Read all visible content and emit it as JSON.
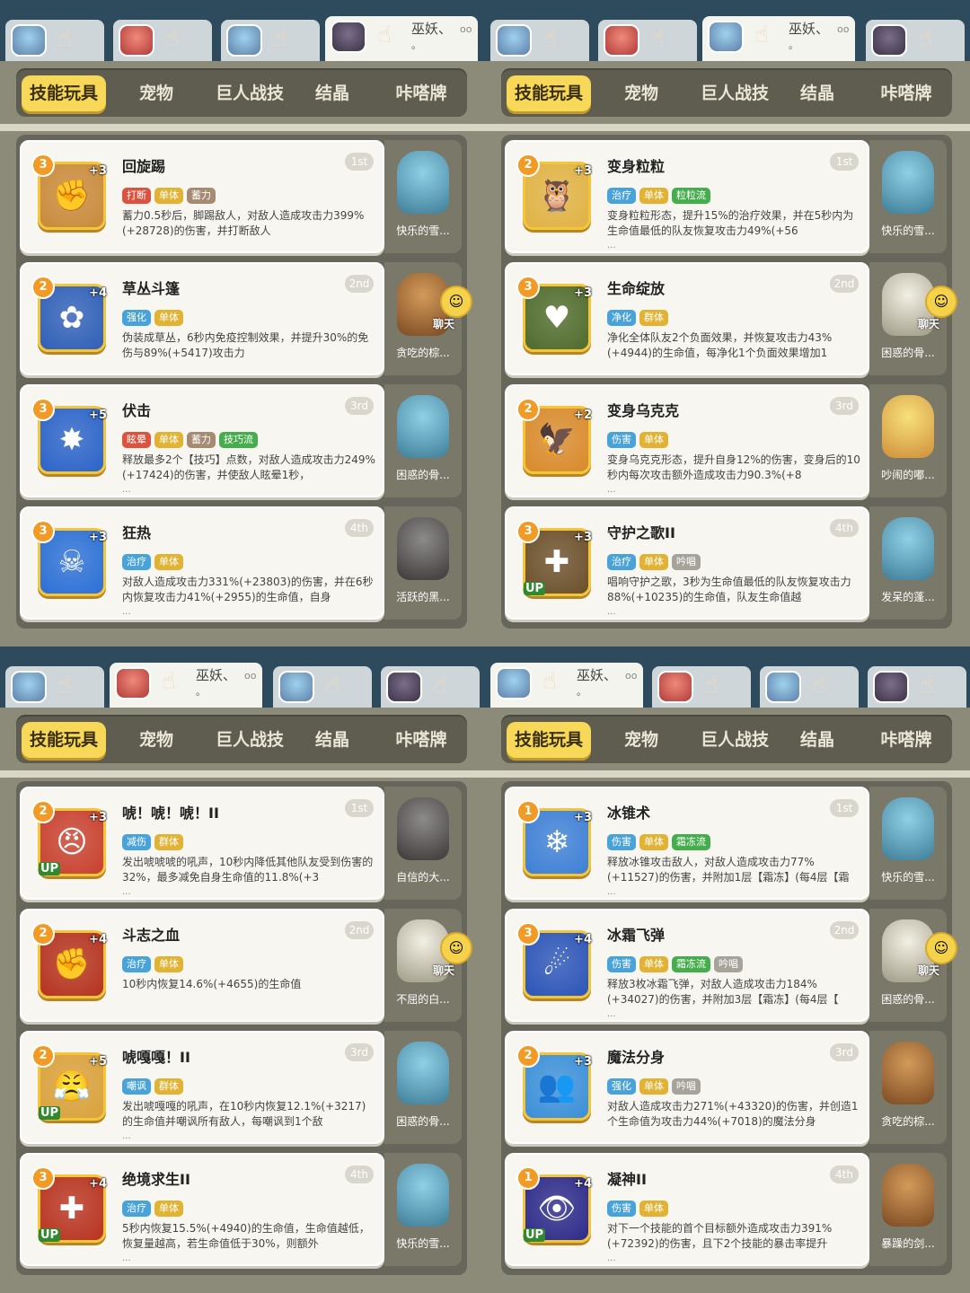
{
  "colors": {
    "tag_zhiliao": "#49a3d9",
    "tag_danti": "#e1b233",
    "tag_xuli": "#a58b72",
    "tag_daduan": "#d9533f",
    "tag_green": "#45ad4c",
    "tag_qianghua": "#49a3d9",
    "tag_qunti": "#e1b233",
    "tag_jinghua": "#49a3d9",
    "tag_yinchang": "#a6a39a",
    "tag_shanghai": "#49a3d9",
    "tag_xuanyun": "#d9533f",
    "tag_jianshang": "#49a3d9",
    "tag_chaofeng": "#49a3d9"
  },
  "quadrants": [
    {
      "player_tabs": [
        {
          "icon": "avatar-blue"
        },
        {
          "icon": "avatar-red"
        },
        {
          "icon": "avatar-blue"
        },
        {
          "name": "巫妖、",
          "dots": "oo",
          "sub": "。",
          "active": true,
          "icon": "avatar-dark"
        }
      ],
      "categories": [
        "技能玩具",
        "宠物",
        "巨人战技",
        "结晶",
        "咔嗒牌"
      ],
      "skills": [
        {
          "name": "回旋踢",
          "rank": "1st",
          "level": "3",
          "plus": "+3",
          "up": "",
          "tags": [
            {
              "t": "打断",
              "c": "tag_daduan"
            },
            {
              "t": "单体",
              "c": "tag_danti"
            },
            {
              "t": "蓄力",
              "c": "tag_xuli"
            }
          ],
          "desc": "蓄力0.5秒后，脚踢敌人，对敌人造成攻击力399%(+28728)的伤害，并打断敌人",
          "more": "",
          "icon_bg": "#c98a3a",
          "glyph": "✊",
          "pet": {
            "name": "快乐的雪...",
            "style": "p-blue",
            "chat": false
          }
        },
        {
          "name": "草丛斗篷",
          "rank": "2nd",
          "level": "2",
          "plus": "+4",
          "up": "",
          "tags": [
            {
              "t": "强化",
              "c": "tag_qianghua"
            },
            {
              "t": "单体",
              "c": "tag_danti"
            }
          ],
          "desc": "伪装成草丛，6秒内免疫控制效果，并提升30%的免伤与89%(+5417)攻击力",
          "more": "",
          "icon_bg": "#2f5fb8",
          "glyph": "✿",
          "pet": {
            "name": "贪吃的棕...",
            "style": "p-brown",
            "chat": true,
            "chat_label": "聊天"
          }
        },
        {
          "name": "伏击",
          "rank": "3rd",
          "level": "3",
          "plus": "+5",
          "up": "",
          "tags": [
            {
              "t": "眩晕",
              "c": "tag_xuanyun"
            },
            {
              "t": "单体",
              "c": "tag_danti"
            },
            {
              "t": "蓄力",
              "c": "tag_xuli"
            },
            {
              "t": "技巧流",
              "c": "tag_green"
            }
          ],
          "desc": "释放最多2个【技巧】点数，对敌人造成攻击力249%(+17424)的伤害，并使敌人眩晕1秒，",
          "more": "...",
          "icon_bg": "#2a63c9",
          "glyph": "✸",
          "pet": {
            "name": "困惑的骨...",
            "style": "p-blue",
            "chat": false
          }
        },
        {
          "name": "狂热",
          "rank": "4th",
          "level": "3",
          "plus": "+3",
          "up": "",
          "tags": [
            {
              "t": "治疗",
              "c": "tag_zhiliao"
            },
            {
              "t": "单体",
              "c": "tag_danti"
            }
          ],
          "desc": "对敌人造成攻击力331%(+23803)的伤害，并在6秒内恢复攻击力41%(+2955)的生命值，自身",
          "more": "...",
          "icon_bg": "#2b6fd6",
          "glyph": "☠",
          "pet": {
            "name": "活跃的黑...",
            "style": "p-dark",
            "chat": false
          }
        }
      ]
    },
    {
      "player_tabs": [
        {
          "icon": "avatar-blue"
        },
        {
          "icon": "avatar-red"
        },
        {
          "name": "巫妖、",
          "dots": "oo",
          "sub": "。",
          "active": true,
          "icon": "avatar-blue"
        },
        {
          "icon": "avatar-dark"
        }
      ],
      "categories": [
        "技能玩具",
        "宠物",
        "巨人战技",
        "结晶",
        "咔嗒牌"
      ],
      "skills": [
        {
          "name": "变身粒粒",
          "rank": "1st",
          "level": "2",
          "plus": "+3",
          "up": "",
          "tags": [
            {
              "t": "治疗",
              "c": "tag_zhiliao"
            },
            {
              "t": "单体",
              "c": "tag_danti"
            },
            {
              "t": "粒粒流",
              "c": "tag_green"
            }
          ],
          "desc": "变身粒粒形态，提升15%的治疗效果，并在5秒内为生命值最低的队友恢复攻击力49%(+56",
          "more": "...",
          "icon_bg": "#e0b243",
          "glyph": "🦉",
          "pet": {
            "name": "快乐的雪...",
            "style": "p-blue",
            "chat": false
          }
        },
        {
          "name": "生命绽放",
          "rank": "2nd",
          "level": "3",
          "plus": "+3",
          "up": "",
          "tags": [
            {
              "t": "净化",
              "c": "tag_jinghua"
            },
            {
              "t": "群体",
              "c": "tag_qunti"
            }
          ],
          "desc": "净化全体队友2个负面效果，并恢复攻击力43%(+4944)的生命值，每净化1个负面效果增加1",
          "more": "",
          "icon_bg": "#4f6b2c",
          "glyph": "♥",
          "pet": {
            "name": "困惑的骨...",
            "style": "p-white",
            "chat": true,
            "chat_label": "聊天"
          }
        },
        {
          "name": "变身乌克克",
          "rank": "3rd",
          "level": "2",
          "plus": "+2",
          "up": "",
          "tags": [
            {
              "t": "伤害",
              "c": "tag_shanghai"
            },
            {
              "t": "单体",
              "c": "tag_danti"
            }
          ],
          "desc": "变身乌克克形态，提升自身12%的伤害，变身后的10秒内每次攻击额外造成攻击力90.3%(+8",
          "more": "...",
          "icon_bg": "#d98a2a",
          "glyph": "🦅",
          "pet": {
            "name": "吵闹的嘟...",
            "style": "p-yellow",
            "chat": false
          }
        },
        {
          "name": "守护之歌II",
          "rank": "4th",
          "level": "3",
          "plus": "+3",
          "up": "UP",
          "tags": [
            {
              "t": "治疗",
              "c": "tag_zhiliao"
            },
            {
              "t": "单体",
              "c": "tag_danti"
            },
            {
              "t": "吟唱",
              "c": "tag_yinchang"
            }
          ],
          "desc": "唱响守护之歌，3秒为生命值最低的队友恢复攻击力88%(+10235)的生命值，队友生命值越",
          "more": "...",
          "icon_bg": "#6b4f2a",
          "glyph": "✚",
          "pet": {
            "name": "发呆的蓬...",
            "style": "p-blue",
            "chat": false
          }
        }
      ]
    },
    {
      "player_tabs": [
        {
          "icon": "avatar-blue"
        },
        {
          "name": "巫妖、",
          "dots": "oo",
          "sub": "。",
          "active": true,
          "icon": "avatar-red"
        },
        {
          "icon": "avatar-blue"
        },
        {
          "icon": "avatar-dark"
        }
      ],
      "categories": [
        "技能玩具",
        "宠物",
        "巨人战技",
        "结晶",
        "咔嗒牌"
      ],
      "skills": [
        {
          "name": "唬！唬！唬！II",
          "rank": "1st",
          "level": "2",
          "plus": "+3",
          "up": "UP",
          "tags": [
            {
              "t": "减伤",
              "c": "tag_jianshang"
            },
            {
              "t": "群体",
              "c": "tag_qunti"
            }
          ],
          "desc": "发出唬唬唬的吼声，10秒内降低其他队友受到伤害的32%，最多减免自身生命值的11.8%(+3",
          "more": "...",
          "icon_bg": "#c8402e",
          "glyph": "😠",
          "pet": {
            "name": "自信的大...",
            "style": "p-dark",
            "chat": false
          }
        },
        {
          "name": "斗志之血",
          "rank": "2nd",
          "level": "2",
          "plus": "+4",
          "up": "",
          "tags": [
            {
              "t": "治疗",
              "c": "tag_zhiliao"
            },
            {
              "t": "单体",
              "c": "tag_danti"
            }
          ],
          "desc": "10秒内恢复14.6%(+4655)的生命值",
          "more": "",
          "icon_bg": "#b5321f",
          "glyph": "✊",
          "pet": {
            "name": "不屈的白...",
            "style": "p-white",
            "chat": true,
            "chat_label": "聊天"
          }
        },
        {
          "name": "唬嘎嘎！II",
          "rank": "3rd",
          "level": "2",
          "plus": "+5",
          "up": "UP",
          "tags": [
            {
              "t": "嘲讽",
              "c": "tag_chaofeng"
            },
            {
              "t": "群体",
              "c": "tag_qunti"
            }
          ],
          "desc": "发出唬嘎嘎的吼声，在10秒内恢复12.1%(+3217)的生命值并嘲讽所有敌人，每嘲讽到1个敌",
          "more": "...",
          "icon_bg": "#d9a13a",
          "glyph": "😤",
          "pet": {
            "name": "困惑的骨...",
            "style": "p-blue",
            "chat": false
          }
        },
        {
          "name": "绝境求生II",
          "rank": "4th",
          "level": "3",
          "plus": "+4",
          "up": "UP",
          "tags": [
            {
              "t": "治疗",
              "c": "tag_zhiliao"
            },
            {
              "t": "单体",
              "c": "tag_danti"
            }
          ],
          "desc": "5秒内恢复15.5%(+4940)的生命值，生命值越低，恢复量越高，若生命值低于30%，则额外",
          "more": "...",
          "icon_bg": "#b8321f",
          "glyph": "✚",
          "pet": {
            "name": "快乐的雪...",
            "style": "p-blue",
            "chat": false
          }
        }
      ]
    },
    {
      "player_tabs": [
        {
          "name": "巫妖、",
          "dots": "oo",
          "sub": "。",
          "active": true,
          "icon": "avatar-blue"
        },
        {
          "icon": "avatar-red"
        },
        {
          "icon": "avatar-blue"
        },
        {
          "icon": "avatar-dark"
        }
      ],
      "categories": [
        "技能玩具",
        "宠物",
        "巨人战技",
        "结晶",
        "咔嗒牌"
      ],
      "skills": [
        {
          "name": "冰锥术",
          "rank": "1st",
          "level": "1",
          "plus": "+3",
          "up": "",
          "tags": [
            {
              "t": "伤害",
              "c": "tag_shanghai"
            },
            {
              "t": "单体",
              "c": "tag_danti"
            },
            {
              "t": "霜冻流",
              "c": "tag_green"
            }
          ],
          "desc": "释放冰锥攻击敌人，对敌人造成攻击力77%(+11527)的伤害，并附加1层【霜冻】(每4层【霜",
          "more": "...",
          "icon_bg": "#3d7fd6",
          "glyph": "❄",
          "pet": {
            "name": "快乐的雪...",
            "style": "p-blue",
            "chat": false
          }
        },
        {
          "name": "冰霜飞弹",
          "rank": "2nd",
          "level": "3",
          "plus": "+4",
          "up": "",
          "tags": [
            {
              "t": "伤害",
              "c": "tag_shanghai"
            },
            {
              "t": "单体",
              "c": "tag_danti"
            },
            {
              "t": "霜冻流",
              "c": "tag_green"
            },
            {
              "t": "吟唱",
              "c": "tag_yinchang"
            }
          ],
          "desc": "释放3枚冰霜飞弹，对敌人造成攻击力184%(+34027)的伤害，并附加3层【霜冻】(每4层【",
          "more": "...",
          "icon_bg": "#2a54b8",
          "glyph": "☄",
          "pet": {
            "name": "困惑的骨...",
            "style": "p-white",
            "chat": true,
            "chat_label": "聊天"
          }
        },
        {
          "name": "魔法分身",
          "rank": "3rd",
          "level": "2",
          "plus": "+3",
          "up": "",
          "tags": [
            {
              "t": "强化",
              "c": "tag_qianghua"
            },
            {
              "t": "单体",
              "c": "tag_danti"
            },
            {
              "t": "吟唱",
              "c": "tag_yinchang"
            }
          ],
          "desc": "对敌人造成攻击力271%(+43320)的伤害，并创造1个生命值为攻击力44%(+7018)的魔法分身",
          "more": "",
          "icon_bg": "#3a8fd9",
          "glyph": "👥",
          "pet": {
            "name": "贪吃的棕...",
            "style": "p-brown",
            "chat": false
          }
        },
        {
          "name": "凝神II",
          "rank": "4th",
          "level": "1",
          "plus": "+4",
          "up": "UP",
          "tags": [
            {
              "t": "伤害",
              "c": "tag_shanghai"
            },
            {
              "t": "单体",
              "c": "tag_danti"
            }
          ],
          "desc": "对下一个技能的首个目标额外造成攻击力391%(+72392)的伤害，且下2个技能的暴击率提升",
          "more": "...",
          "icon_bg": "#2c2a8a",
          "glyph": "👁",
          "pet": {
            "name": "暴躁的剑...",
            "style": "p-brown",
            "chat": false
          }
        }
      ]
    }
  ]
}
